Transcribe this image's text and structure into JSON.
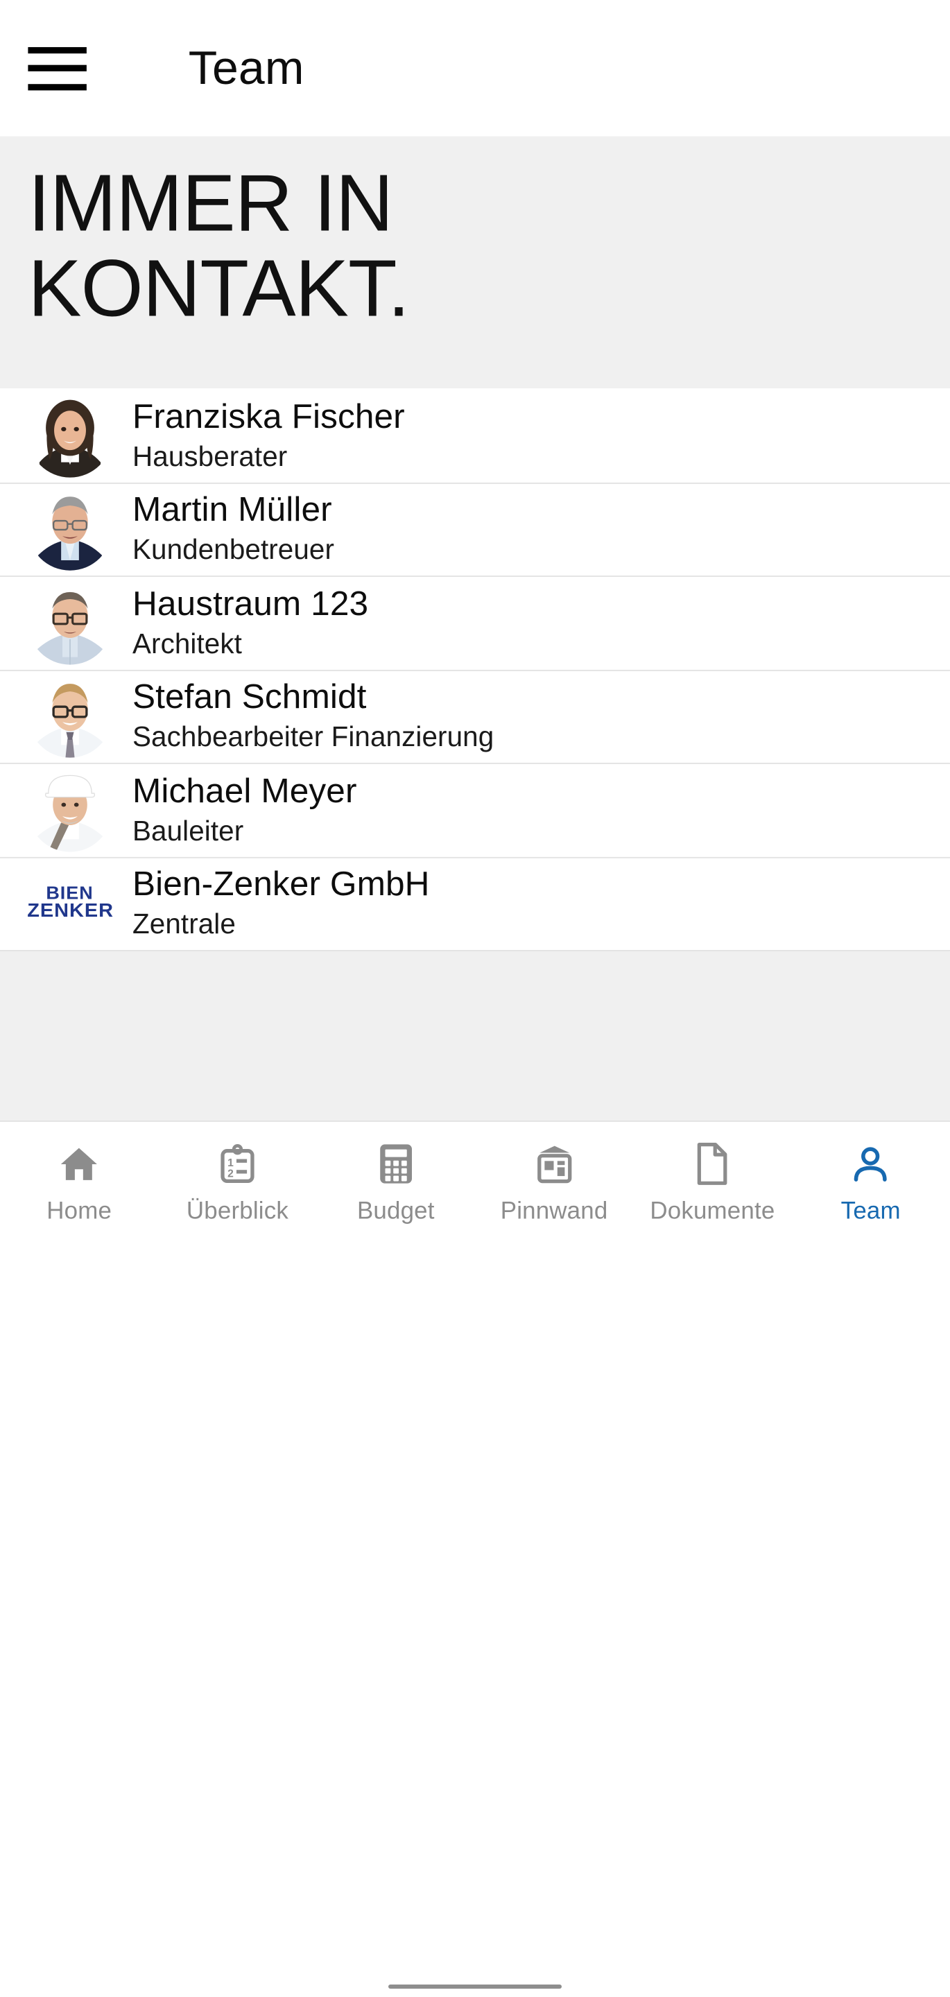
{
  "appbar": {
    "menu_icon": "hamburger-menu-icon",
    "title": "Team"
  },
  "hero": {
    "line1": "IMMER IN",
    "line2": "KONTAKT."
  },
  "contacts": [
    {
      "name": "Franziska Fischer",
      "role": "Hausberater",
      "avatar": "photo-woman-dark-hair-blazer"
    },
    {
      "name": "Martin Müller",
      "role": "Kundenbetreuer",
      "avatar": "photo-man-glasses-navy-blazer"
    },
    {
      "name": "Haustraum 123",
      "role": "Architekt",
      "avatar": "photo-man-glasses-light-shirt"
    },
    {
      "name": "Stefan Schmidt",
      "role": "Sachbearbeiter Finanzierung",
      "avatar": "photo-man-glasses-shirt-tie"
    },
    {
      "name": "Michael Meyer",
      "role": "Bauleiter",
      "avatar": "photo-man-white-hardhat"
    },
    {
      "name": "Bien-Zenker GmbH",
      "role": "Zentrale",
      "avatar": "bien-zenker-logo",
      "logo": {
        "line1": "BIEN",
        "line2": "ZENKER"
      }
    }
  ],
  "tabs": [
    {
      "label": "Home",
      "icon": "home-icon",
      "active": false
    },
    {
      "label": "Überblick",
      "icon": "clipboard-list-icon",
      "active": false
    },
    {
      "label": "Budget",
      "icon": "calculator-icon",
      "active": false
    },
    {
      "label": "Pinnwand",
      "icon": "bulletin-board-icon",
      "active": false
    },
    {
      "label": "Dokumente",
      "icon": "document-icon",
      "active": false
    },
    {
      "label": "Team",
      "icon": "person-icon",
      "active": true
    }
  ],
  "colors": {
    "accent": "#1769b0",
    "inactive": "#8c8c8c",
    "hero_bg": "#f0f0f0",
    "divider": "#e2e2e2",
    "brand_blue": "#20378c",
    "text": "#0d0d0d"
  }
}
